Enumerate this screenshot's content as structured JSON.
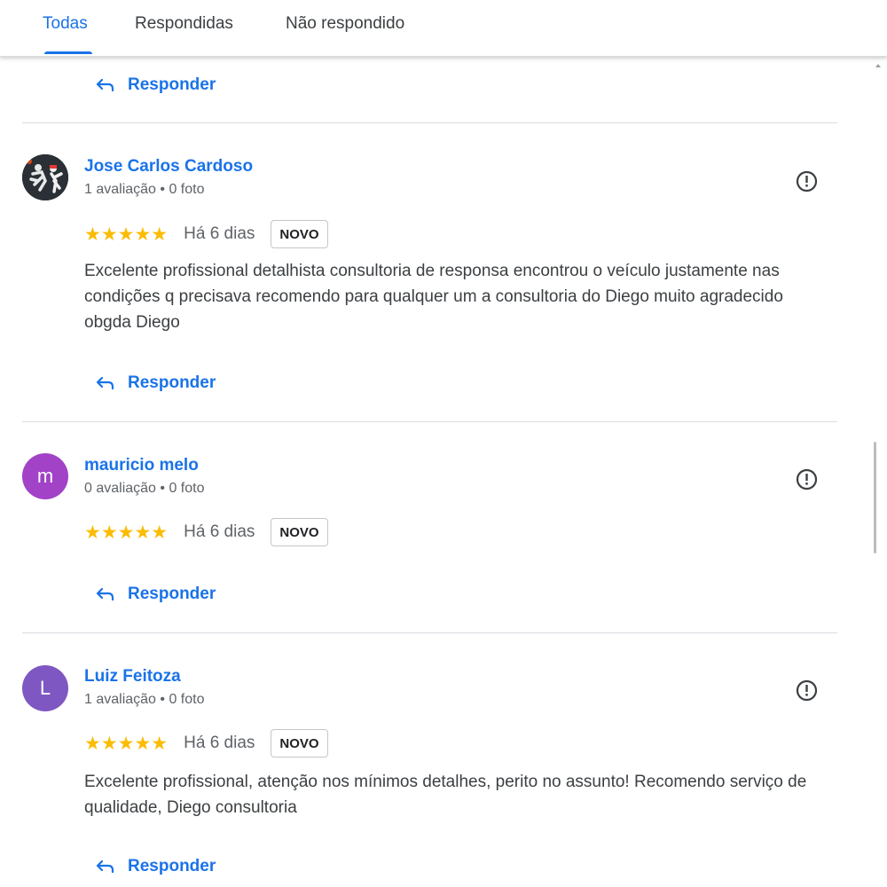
{
  "tabs": [
    {
      "label": "Todas",
      "active": true
    },
    {
      "label": "Respondidas",
      "active": false
    },
    {
      "label": "Não respondido",
      "active": false
    }
  ],
  "reply_label": "Responder",
  "reviews": [
    {
      "name": "Jose Carlos Cardoso",
      "meta": "1 avaliação • 0 foto",
      "avatar": "photo",
      "stars": "★★★★★",
      "rating": 5,
      "date": "Há 6 dias",
      "badge": "NOVO",
      "text": "Excelente profissional detalhista consultoria de responsa encontrou o veículo justamente nas condições q precisava recomendo para qualquer um a consultoria do Diego muito agradecido obgda Diego"
    },
    {
      "name": "mauricio melo",
      "meta": "0 avaliação • 0 foto",
      "avatar_letter": "m",
      "avatar_color": "#a142c7",
      "stars": "★★★★★",
      "rating": 5,
      "date": "Há 6 dias",
      "badge": "NOVO",
      "text": ""
    },
    {
      "name": "Luiz Feitoza",
      "meta": "1 avaliação • 0 foto",
      "avatar_letter": "L",
      "avatar_color": "#7e57c2",
      "stars": "★★★★★",
      "rating": 5,
      "date": "Há 6 dias",
      "badge": "NOVO",
      "text": "Excelente profissional, atenção nos mínimos detalhes, perito no assunto! Recomendo serviço de qualidade, Diego consultoria"
    }
  ],
  "icons": {
    "reply": "reply-arrow-icon",
    "flag": "report-exclamation-icon"
  },
  "colors": {
    "accent": "#1a73e8",
    "star": "#fbbc04"
  }
}
